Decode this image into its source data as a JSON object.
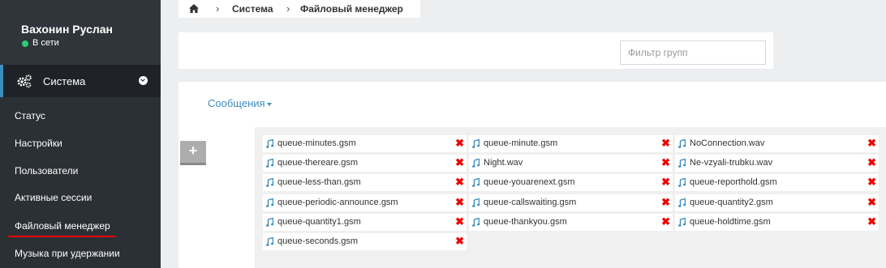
{
  "user": {
    "name": "Вахонин Руслан",
    "status": "В сети",
    "status_color": "#2ecc71"
  },
  "nav": {
    "section_label": "Система",
    "section_icon": "gears-icon",
    "items": [
      {
        "label": "Статус"
      },
      {
        "label": "Настройки"
      },
      {
        "label": "Пользователи"
      },
      {
        "label": "Активные сессии"
      },
      {
        "label": "Файловый менеджер",
        "active": true
      },
      {
        "label": "Музыка при удержании"
      }
    ]
  },
  "breadcrumb": {
    "home_icon": "home-icon",
    "items": [
      "Система",
      "Файловый менеджер"
    ]
  },
  "filter": {
    "placeholder": "Фильтр групп",
    "value": ""
  },
  "group_dropdown": {
    "label": "Сообщения"
  },
  "add_button": {
    "label": "+"
  },
  "files": {
    "icon": "music-note-icon",
    "delete_label": "✖",
    "columns": [
      [
        "queue-minutes.gsm",
        "queue-thereare.gsm",
        "queue-less-than.gsm",
        "queue-periodic-announce.gsm",
        "queue-quantity1.gsm",
        "queue-seconds.gsm"
      ],
      [
        "queue-minute.gsm",
        "Night.wav",
        "queue-youarenext.gsm",
        "queue-callswaiting.gsm",
        "queue-thankyou.gsm"
      ],
      [
        "NoConnection.wav",
        "Ne-vzyali-trubku.wav",
        "queue-reporthold.gsm",
        "queue-quantity2.gsm",
        "queue-holdtime.gsm"
      ]
    ]
  },
  "colors": {
    "accent": "#3c8dbc",
    "sidebar": "#2b3035",
    "delete": "#e00000"
  }
}
